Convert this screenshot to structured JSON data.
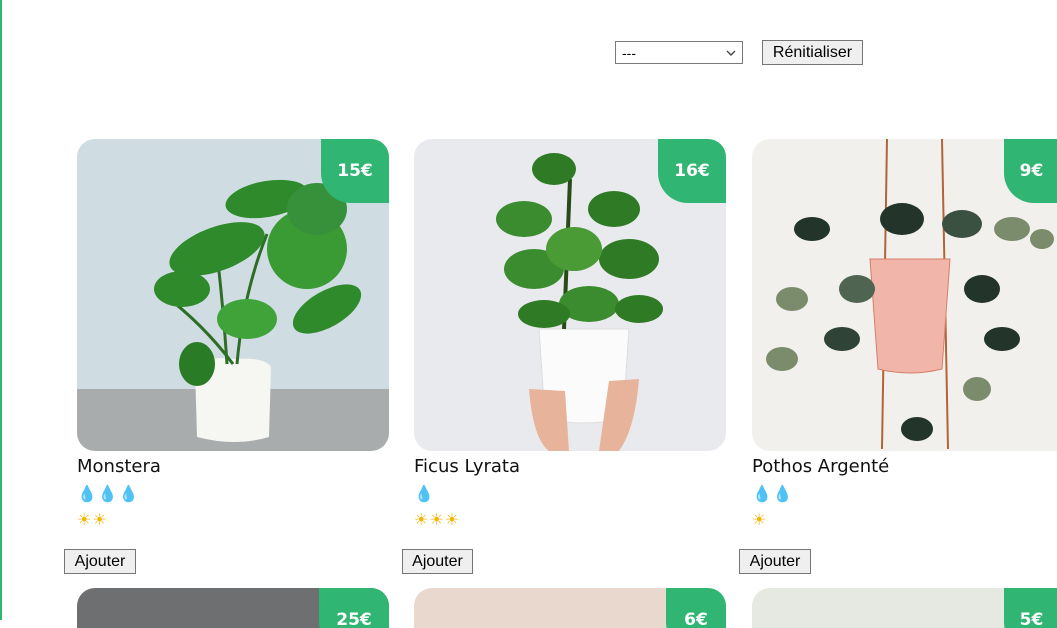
{
  "filter": {
    "selected": "---",
    "reset_label": "Rénitialiser"
  },
  "plants": [
    {
      "name": "Monstera",
      "price": "15€",
      "water": 3,
      "light": 2
    },
    {
      "name": "Ficus Lyrata",
      "price": "16€",
      "water": 1,
      "light": 3
    },
    {
      "name": "Pothos Argenté",
      "price": "9€",
      "water": 2,
      "light": 1
    },
    {
      "name": "",
      "price": "25€"
    },
    {
      "name": "",
      "price": "6€"
    },
    {
      "name": "",
      "price": "5€"
    }
  ],
  "add_label": "Ajouter",
  "colors": {
    "accent": "#31b572",
    "water": "#3a8fd6",
    "sun": "#f5b400"
  },
  "icons": {
    "water": "water-drop-icon",
    "light": "sun-icon",
    "dropdown": "chevron-down-icon"
  }
}
